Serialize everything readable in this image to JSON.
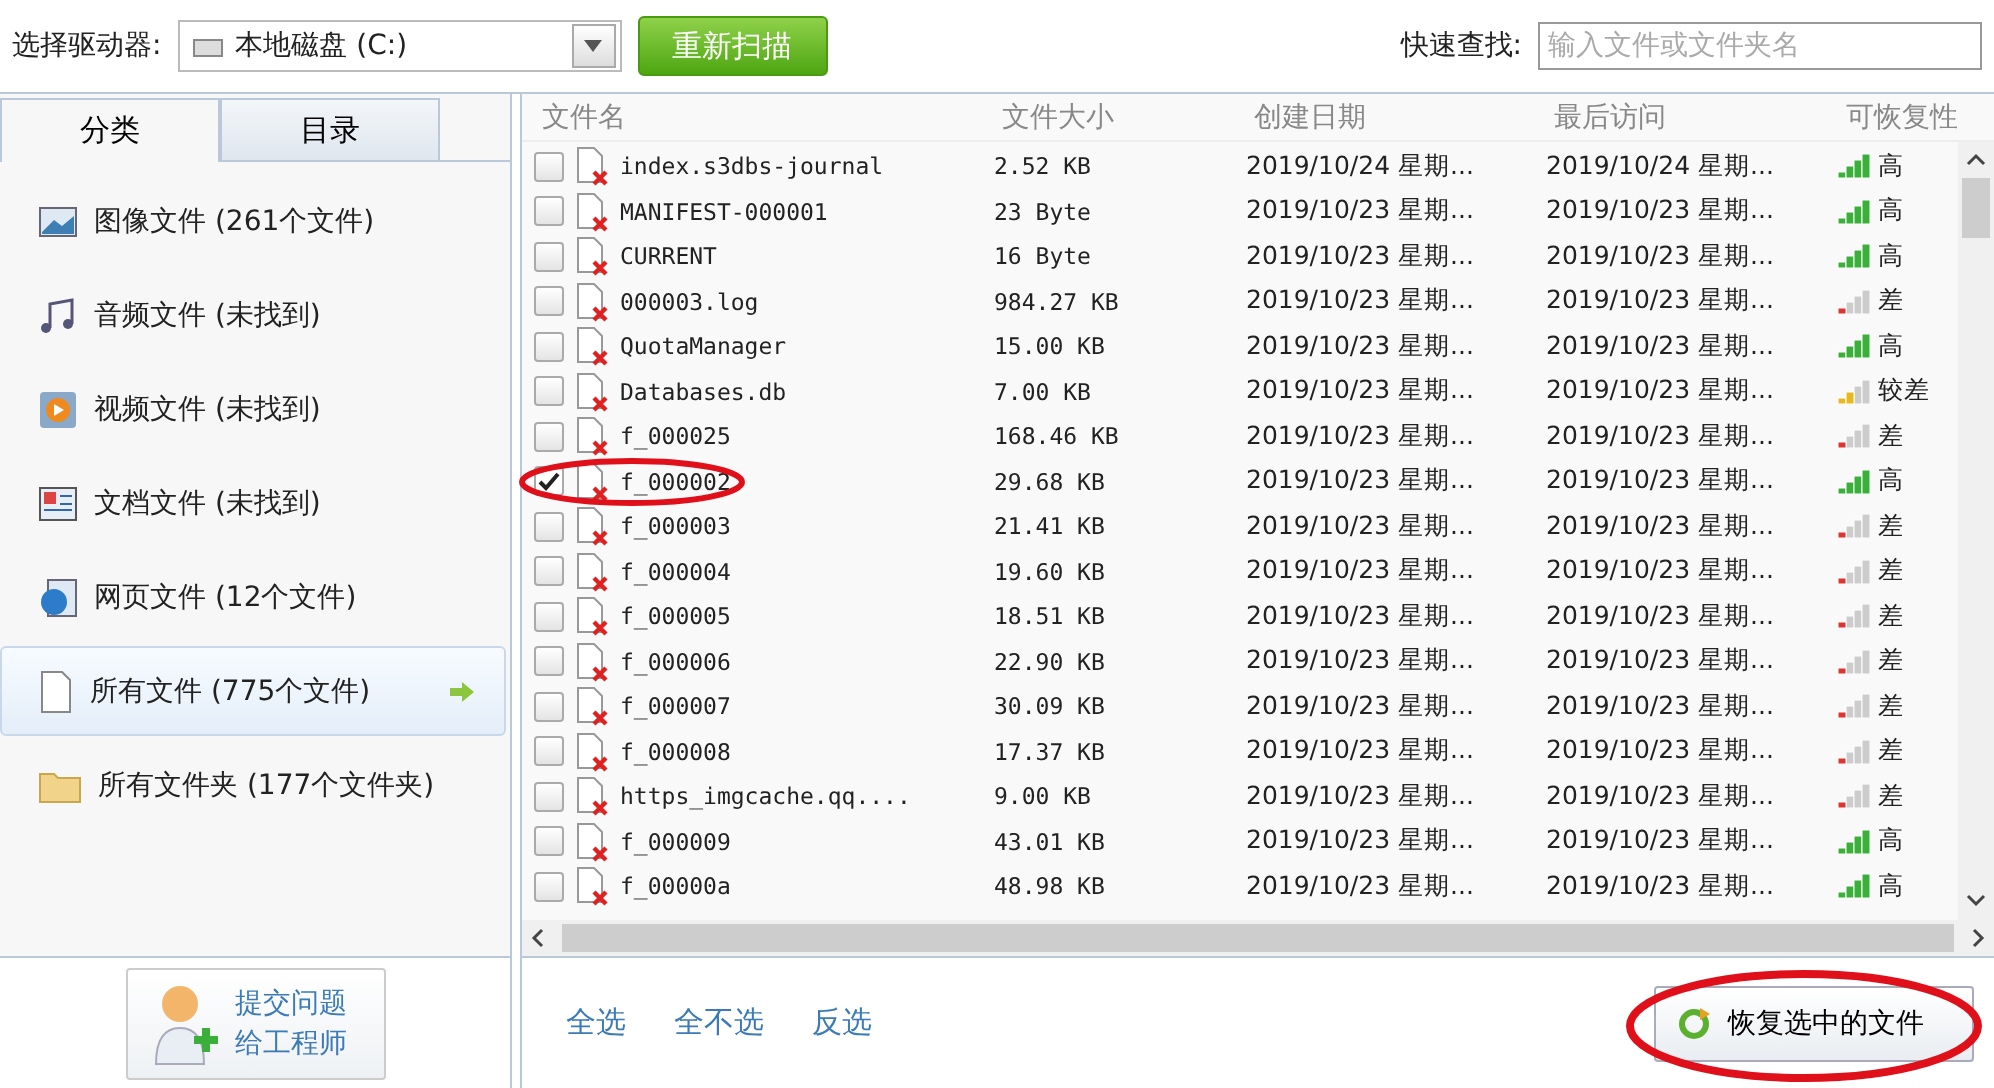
{
  "toolbar": {
    "drive_label": "选择驱动器:",
    "drive": "本地磁盘 (C:)",
    "rescan": "重新扫描",
    "search_label": "快速查找:",
    "search_placeholder": "输入文件或文件夹名"
  },
  "tabs": [
    {
      "label": "分类",
      "selected": true
    },
    {
      "label": "目录",
      "selected": false
    }
  ],
  "categories": [
    {
      "kind": "image",
      "label": "图像文件 (261个文件)",
      "selected": false
    },
    {
      "kind": "audio",
      "label": "音频文件 (未找到)",
      "selected": false
    },
    {
      "kind": "video",
      "label": "视频文件 (未找到)",
      "selected": false
    },
    {
      "kind": "doc",
      "label": "文档文件 (未找到)",
      "selected": false
    },
    {
      "kind": "web",
      "label": "网页文件 (12个文件)",
      "selected": false
    },
    {
      "kind": "file",
      "label": "所有文件 (775个文件)",
      "selected": true
    },
    {
      "kind": "folder",
      "label": "所有文件夹 (177个文件夹)",
      "selected": false
    }
  ],
  "support_button": [
    "提交问题",
    "给工程师"
  ],
  "table": {
    "columns": [
      "文件名",
      "文件大小",
      "创建日期",
      "最后访问",
      "可恢复性"
    ],
    "rows": [
      {
        "checked": false,
        "name": "index.s3dbs-journal",
        "size": "2.52 KB",
        "created": "2019/10/24 星期...",
        "accessed": "2019/10/24 星期...",
        "level": 1,
        "rating": "高"
      },
      {
        "checked": false,
        "name": "MANIFEST-000001",
        "size": "23 Byte",
        "created": "2019/10/23 星期...",
        "accessed": "2019/10/23 星期...",
        "level": 1,
        "rating": "高"
      },
      {
        "checked": false,
        "name": "CURRENT",
        "size": "16 Byte",
        "created": "2019/10/23 星期...",
        "accessed": "2019/10/23 星期...",
        "level": 1,
        "rating": "高"
      },
      {
        "checked": false,
        "name": "000003.log",
        "size": "984.27 KB",
        "created": "2019/10/23 星期...",
        "accessed": "2019/10/23 星期...",
        "level": 0.25,
        "rating": "差"
      },
      {
        "checked": false,
        "name": "QuotaManager",
        "size": "15.00 KB",
        "created": "2019/10/23 星期...",
        "accessed": "2019/10/23 星期...",
        "level": 1,
        "rating": "高"
      },
      {
        "checked": false,
        "name": "Databases.db",
        "size": "7.00 KB",
        "created": "2019/10/23 星期...",
        "accessed": "2019/10/23 星期...",
        "level": 0.5,
        "rating": "较差"
      },
      {
        "checked": false,
        "name": "f_000025",
        "size": "168.46 KB",
        "created": "2019/10/23 星期...",
        "accessed": "2019/10/23 星期...",
        "level": 0.25,
        "rating": "差"
      },
      {
        "checked": true,
        "name": "f_000002",
        "size": "29.68 KB",
        "created": "2019/10/23 星期...",
        "accessed": "2019/10/23 星期...",
        "level": 1,
        "rating": "高"
      },
      {
        "checked": false,
        "name": "f_000003",
        "size": "21.41 KB",
        "created": "2019/10/23 星期...",
        "accessed": "2019/10/23 星期...",
        "level": 0.25,
        "rating": "差"
      },
      {
        "checked": false,
        "name": "f_000004",
        "size": "19.60 KB",
        "created": "2019/10/23 星期...",
        "accessed": "2019/10/23 星期...",
        "level": 0.25,
        "rating": "差"
      },
      {
        "checked": false,
        "name": "f_000005",
        "size": "18.51 KB",
        "created": "2019/10/23 星期...",
        "accessed": "2019/10/23 星期...",
        "level": 0.25,
        "rating": "差"
      },
      {
        "checked": false,
        "name": "f_000006",
        "size": "22.90 KB",
        "created": "2019/10/23 星期...",
        "accessed": "2019/10/23 星期...",
        "level": 0.25,
        "rating": "差"
      },
      {
        "checked": false,
        "name": "f_000007",
        "size": "30.09 KB",
        "created": "2019/10/23 星期...",
        "accessed": "2019/10/23 星期...",
        "level": 0.25,
        "rating": "差"
      },
      {
        "checked": false,
        "name": "f_000008",
        "size": "17.37 KB",
        "created": "2019/10/23 星期...",
        "accessed": "2019/10/23 星期...",
        "level": 0.25,
        "rating": "差"
      },
      {
        "checked": false,
        "name": "https_imgcache.qq....",
        "size": "9.00 KB",
        "created": "2019/10/23 星期...",
        "accessed": "2019/10/23 星期...",
        "level": 0.25,
        "rating": "差"
      },
      {
        "checked": false,
        "name": "f_000009",
        "size": "43.01 KB",
        "created": "2019/10/23 星期...",
        "accessed": "2019/10/23 星期...",
        "level": 1,
        "rating": "高"
      },
      {
        "checked": false,
        "name": "f_00000a",
        "size": "48.98 KB",
        "created": "2019/10/23 星期...",
        "accessed": "2019/10/23 星期...",
        "level": 1,
        "rating": "高"
      }
    ]
  },
  "selection_links": [
    "全选",
    "全不选",
    "反选"
  ],
  "recover_button": "恢复选中的文件"
}
